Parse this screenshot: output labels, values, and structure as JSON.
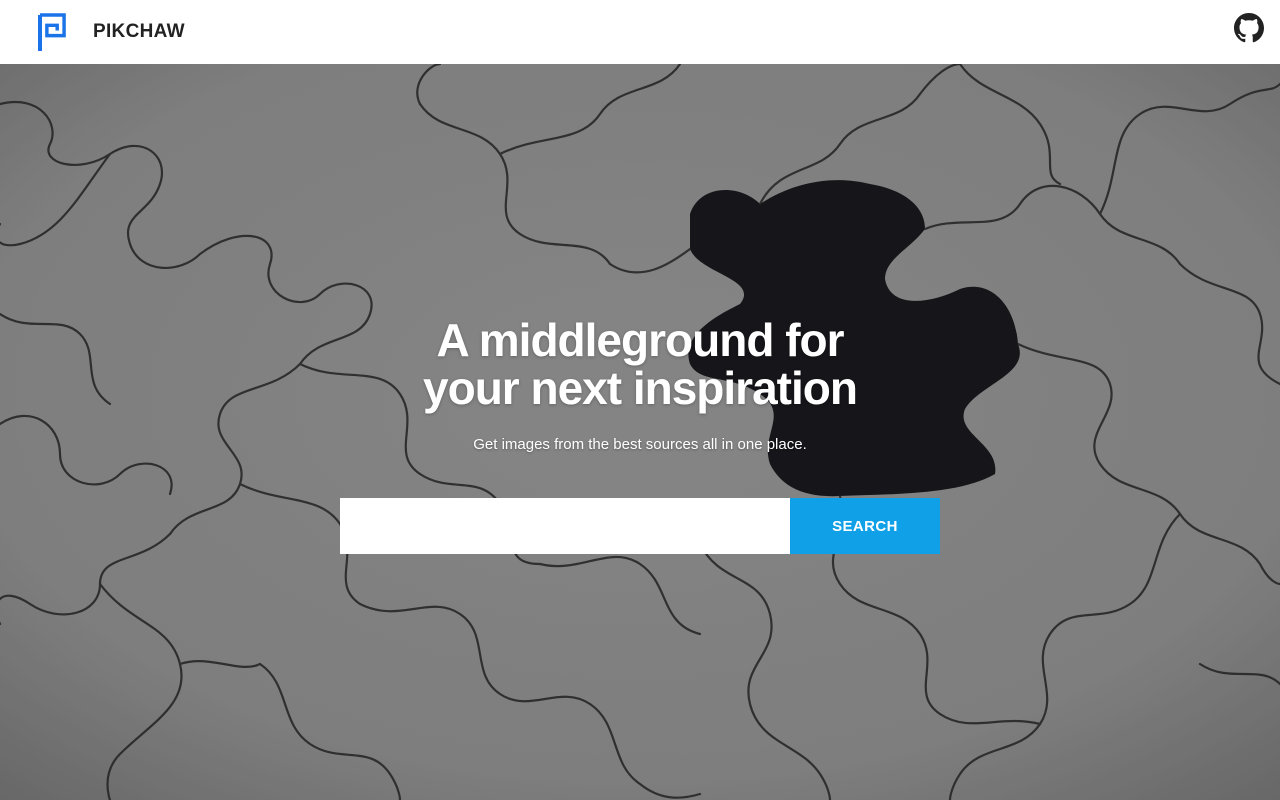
{
  "navbar": {
    "brand_name": "PIKCHAW",
    "logo_icon": "pikchaw-logo-icon",
    "github_icon": "github-icon",
    "colors": {
      "logo": "#1a73e8",
      "brand_text": "#222222",
      "github": "#222222"
    }
  },
  "hero": {
    "headline_line1": "A middleground for",
    "headline_line2": "your next inspiration",
    "subtitle": "Get images from the best sources all in one place.",
    "background": "jigsaw-puzzle-missing-piece"
  },
  "search": {
    "placeholder": "",
    "value": "",
    "button_label": "SEARCH",
    "button_color": "#10a0e8"
  }
}
